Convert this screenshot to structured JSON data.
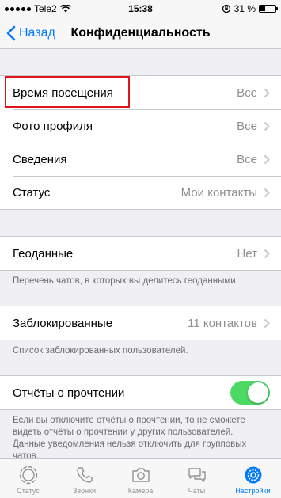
{
  "status_bar": {
    "carrier": "Tele2",
    "time": "15:38",
    "battery_percent": "31 %",
    "battery_level": 0.31
  },
  "nav": {
    "back_label": "Назад",
    "title": "Конфиденциальность"
  },
  "group1": {
    "rows": [
      {
        "label": "Время посещения",
        "value": "Все"
      },
      {
        "label": "Фото профиля",
        "value": "Все"
      },
      {
        "label": "Сведения",
        "value": "Все"
      },
      {
        "label": "Статус",
        "value": "Мои контакты"
      }
    ]
  },
  "location": {
    "label": "Геоданные",
    "value": "Нет",
    "footnote": "Перечень чатов, в которых вы делитесь геоданными."
  },
  "blocked": {
    "label": "Заблокированные",
    "value": "11 контактов",
    "footnote": "Список заблокированных пользователей."
  },
  "read_receipts": {
    "label": "Отчёты о прочтении",
    "enabled": true,
    "footnote": "Если вы отключите отчёты о прочтении, то не сможете видеть отчёты о прочтении у других пользователей. Данные уведомления нельзя отключить для групповых чатов."
  },
  "tabs": [
    {
      "label": "Статус",
      "icon": "status-icon"
    },
    {
      "label": "Звонки",
      "icon": "phone-icon"
    },
    {
      "label": "Камера",
      "icon": "camera-icon"
    },
    {
      "label": "Чаты",
      "icon": "chats-icon"
    },
    {
      "label": "Настройки",
      "icon": "settings-icon",
      "active": true
    }
  ],
  "colors": {
    "accent": "#007aff",
    "toggle_on": "#4cd964",
    "highlight": "#e3121b"
  }
}
